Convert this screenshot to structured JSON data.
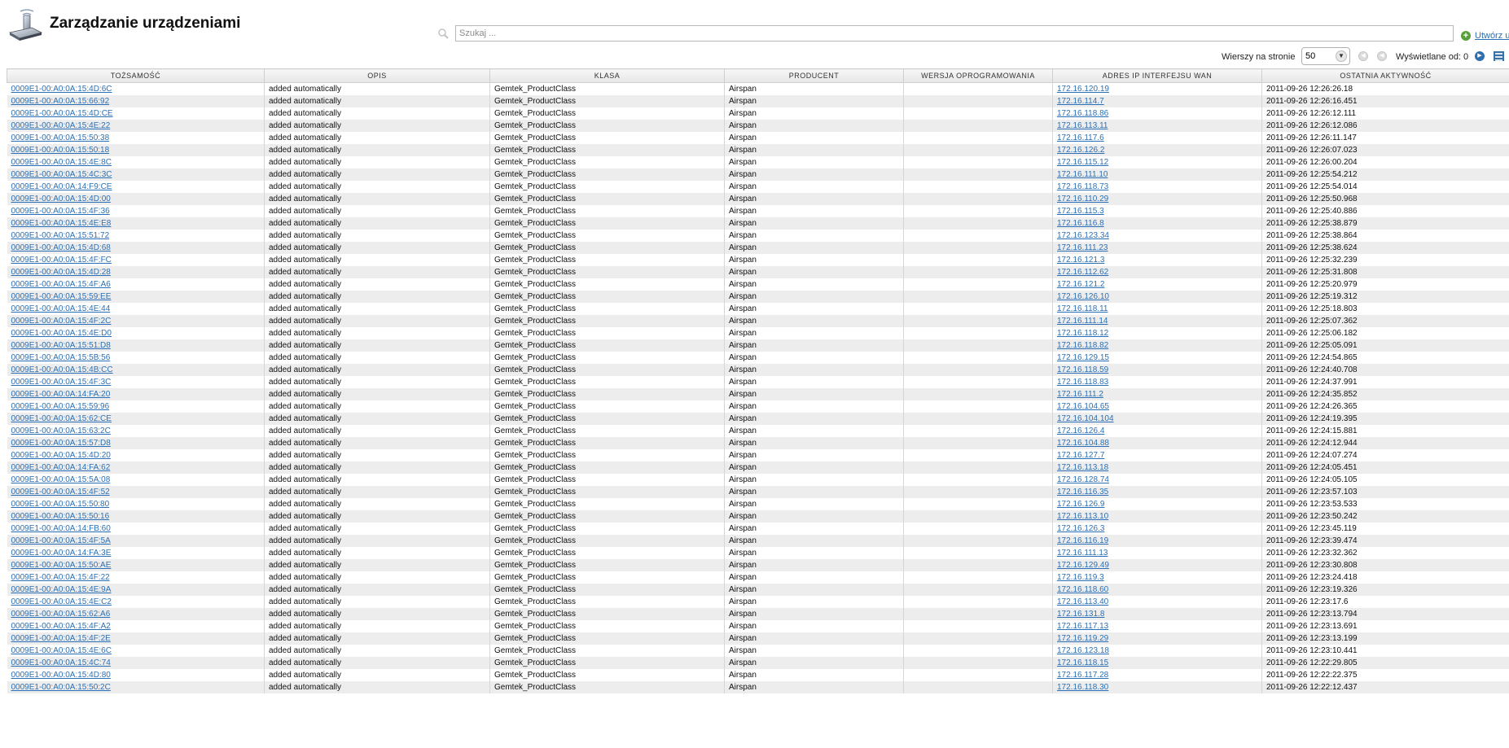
{
  "header": {
    "title": "Zarządzanie urządzeniami",
    "search_placeholder": "Szukaj ...",
    "create_label": "Utwórz u"
  },
  "pager": {
    "rows_label": "Wierszy na stronie",
    "rows_value": "50",
    "shown_label": "Wyświetlane od: 0"
  },
  "table": {
    "columns": [
      "TOŻSAMOŚĆ",
      "OPIS",
      "KLASA",
      "PRODUCENT",
      "WERSJA OPROGRAMOWANIA",
      "ADRES IP INTERFEJSU WAN",
      "OSTATNIA AKTYWNOŚĆ"
    ],
    "rows": [
      [
        "0009E1-00:A0:0A:15:4D:6C",
        "added automatically",
        "Gemtek_ProductClass",
        "Airspan",
        "",
        "172.16.120.19",
        "2011-09-26 12:26:26.18"
      ],
      [
        "0009E1-00:A0:0A:15:66:92",
        "added automatically",
        "Gemtek_ProductClass",
        "Airspan",
        "",
        "172.16.114.7",
        "2011-09-26 12:26:16.451"
      ],
      [
        "0009E1-00:A0:0A:15:4D:CE",
        "added automatically",
        "Gemtek_ProductClass",
        "Airspan",
        "",
        "172.16.118.86",
        "2011-09-26 12:26:12.111"
      ],
      [
        "0009E1-00:A0:0A:15:4E:22",
        "added automatically",
        "Gemtek_ProductClass",
        "Airspan",
        "",
        "172.16.113.11",
        "2011-09-26 12:26:12.086"
      ],
      [
        "0009E1-00:A0:0A:15:50:38",
        "added automatically",
        "Gemtek_ProductClass",
        "Airspan",
        "",
        "172.16.117.6",
        "2011-09-26 12:26:11.147"
      ],
      [
        "0009E1-00:A0:0A:15:50:18",
        "added automatically",
        "Gemtek_ProductClass",
        "Airspan",
        "",
        "172.16.126.2",
        "2011-09-26 12:26:07.023"
      ],
      [
        "0009E1-00:A0:0A:15:4E:8C",
        "added automatically",
        "Gemtek_ProductClass",
        "Airspan",
        "",
        "172.16.115.12",
        "2011-09-26 12:26:00.204"
      ],
      [
        "0009E1-00:A0:0A:15:4C:3C",
        "added automatically",
        "Gemtek_ProductClass",
        "Airspan",
        "",
        "172.16.111.10",
        "2011-09-26 12:25:54.212"
      ],
      [
        "0009E1-00:A0:0A:14:F9:CE",
        "added automatically",
        "Gemtek_ProductClass",
        "Airspan",
        "",
        "172.16.118.73",
        "2011-09-26 12:25:54.014"
      ],
      [
        "0009E1-00:A0:0A:15:4D:00",
        "added automatically",
        "Gemtek_ProductClass",
        "Airspan",
        "",
        "172.16.110.29",
        "2011-09-26 12:25:50.968"
      ],
      [
        "0009E1-00:A0:0A:15:4F:36",
        "added automatically",
        "Gemtek_ProductClass",
        "Airspan",
        "",
        "172.16.115.3",
        "2011-09-26 12:25:40.886"
      ],
      [
        "0009E1-00:A0:0A:15:4E:E8",
        "added automatically",
        "Gemtek_ProductClass",
        "Airspan",
        "",
        "172.16.116.8",
        "2011-09-26 12:25:38.879"
      ],
      [
        "0009E1-00:A0:0A:15:51:72",
        "added automatically",
        "Gemtek_ProductClass",
        "Airspan",
        "",
        "172.16.123.34",
        "2011-09-26 12:25:38.864"
      ],
      [
        "0009E1-00:A0:0A:15:4D:68",
        "added automatically",
        "Gemtek_ProductClass",
        "Airspan",
        "",
        "172.16.111.23",
        "2011-09-26 12:25:38.624"
      ],
      [
        "0009E1-00:A0:0A:15:4F:FC",
        "added automatically",
        "Gemtek_ProductClass",
        "Airspan",
        "",
        "172.16.121.3",
        "2011-09-26 12:25:32.239"
      ],
      [
        "0009E1-00:A0:0A:15:4D:28",
        "added automatically",
        "Gemtek_ProductClass",
        "Airspan",
        "",
        "172.16.112.62",
        "2011-09-26 12:25:31.808"
      ],
      [
        "0009E1-00:A0:0A:15:4F:A6",
        "added automatically",
        "Gemtek_ProductClass",
        "Airspan",
        "",
        "172.16.121.2",
        "2011-09-26 12:25:20.979"
      ],
      [
        "0009E1-00:A0:0A:15:59:EE",
        "added automatically",
        "Gemtek_ProductClass",
        "Airspan",
        "",
        "172.16.126.10",
        "2011-09-26 12:25:19.312"
      ],
      [
        "0009E1-00:A0:0A:15:4E:44",
        "added automatically",
        "Gemtek_ProductClass",
        "Airspan",
        "",
        "172.16.118.11",
        "2011-09-26 12:25:18.803"
      ],
      [
        "0009E1-00:A0:0A:15:4F:2C",
        "added automatically",
        "Gemtek_ProductClass",
        "Airspan",
        "",
        "172.16.111.14",
        "2011-09-26 12:25:07.362"
      ],
      [
        "0009E1-00:A0:0A:15:4E:D0",
        "added automatically",
        "Gemtek_ProductClass",
        "Airspan",
        "",
        "172.16.118.12",
        "2011-09-26 12:25:06.182"
      ],
      [
        "0009E1-00:A0:0A:15:51:D8",
        "added automatically",
        "Gemtek_ProductClass",
        "Airspan",
        "",
        "172.16.118.82",
        "2011-09-26 12:25:05.091"
      ],
      [
        "0009E1-00:A0:0A:15:5B:56",
        "added automatically",
        "Gemtek_ProductClass",
        "Airspan",
        "",
        "172.16.129.15",
        "2011-09-26 12:24:54.865"
      ],
      [
        "0009E1-00:A0:0A:15:4B:CC",
        "added automatically",
        "Gemtek_ProductClass",
        "Airspan",
        "",
        "172.16.118.59",
        "2011-09-26 12:24:40.708"
      ],
      [
        "0009E1-00:A0:0A:15:4F:3C",
        "added automatically",
        "Gemtek_ProductClass",
        "Airspan",
        "",
        "172.16.118.83",
        "2011-09-26 12:24:37.991"
      ],
      [
        "0009E1-00:A0:0A:14:FA:20",
        "added automatically",
        "Gemtek_ProductClass",
        "Airspan",
        "",
        "172.16.111.2",
        "2011-09-26 12:24:35.852"
      ],
      [
        "0009E1-00:A0:0A:15:59:96",
        "added automatically",
        "Gemtek_ProductClass",
        "Airspan",
        "",
        "172.16.104.65",
        "2011-09-26 12:24:26.365"
      ],
      [
        "0009E1-00:A0:0A:15:62:CE",
        "added automatically",
        "Gemtek_ProductClass",
        "Airspan",
        "",
        "172.16.104.104",
        "2011-09-26 12:24:19.395"
      ],
      [
        "0009E1-00:A0:0A:15:63:2C",
        "added automatically",
        "Gemtek_ProductClass",
        "Airspan",
        "",
        "172.16.126.4",
        "2011-09-26 12:24:15.881"
      ],
      [
        "0009E1-00:A0:0A:15:57:D8",
        "added automatically",
        "Gemtek_ProductClass",
        "Airspan",
        "",
        "172.16.104.88",
        "2011-09-26 12:24:12.944"
      ],
      [
        "0009E1-00:A0:0A:15:4D:20",
        "added automatically",
        "Gemtek_ProductClass",
        "Airspan",
        "",
        "172.16.127.7",
        "2011-09-26 12:24:07.274"
      ],
      [
        "0009E1-00:A0:0A:14:FA:62",
        "added automatically",
        "Gemtek_ProductClass",
        "Airspan",
        "",
        "172.16.113.18",
        "2011-09-26 12:24:05.451"
      ],
      [
        "0009E1-00:A0:0A:15:5A:08",
        "added automatically",
        "Gemtek_ProductClass",
        "Airspan",
        "",
        "172.16.128.74",
        "2011-09-26 12:24:05.105"
      ],
      [
        "0009E1-00:A0:0A:15:4F:52",
        "added automatically",
        "Gemtek_ProductClass",
        "Airspan",
        "",
        "172.16.116.35",
        "2011-09-26 12:23:57.103"
      ],
      [
        "0009E1-00:A0:0A:15:50:80",
        "added automatically",
        "Gemtek_ProductClass",
        "Airspan",
        "",
        "172.16.126.9",
        "2011-09-26 12:23:53.533"
      ],
      [
        "0009E1-00:A0:0A:15:50:16",
        "added automatically",
        "Gemtek_ProductClass",
        "Airspan",
        "",
        "172.16.113.10",
        "2011-09-26 12:23:50.242"
      ],
      [
        "0009E1-00:A0:0A:14:FB:60",
        "added automatically",
        "Gemtek_ProductClass",
        "Airspan",
        "",
        "172.16.126.3",
        "2011-09-26 12:23:45.119"
      ],
      [
        "0009E1-00:A0:0A:15:4F:5A",
        "added automatically",
        "Gemtek_ProductClass",
        "Airspan",
        "",
        "172.16.116.19",
        "2011-09-26 12:23:39.474"
      ],
      [
        "0009E1-00:A0:0A:14:FA:3E",
        "added automatically",
        "Gemtek_ProductClass",
        "Airspan",
        "",
        "172.16.111.13",
        "2011-09-26 12:23:32.362"
      ],
      [
        "0009E1-00:A0:0A:15:50:AE",
        "added automatically",
        "Gemtek_ProductClass",
        "Airspan",
        "",
        "172.16.129.49",
        "2011-09-26 12:23:30.808"
      ],
      [
        "0009E1-00:A0:0A:15:4F:22",
        "added automatically",
        "Gemtek_ProductClass",
        "Airspan",
        "",
        "172.16.119.3",
        "2011-09-26 12:23:24.418"
      ],
      [
        "0009E1-00:A0:0A:15:4E:9A",
        "added automatically",
        "Gemtek_ProductClass",
        "Airspan",
        "",
        "172.16.118.60",
        "2011-09-26 12:23:19.326"
      ],
      [
        "0009E1-00:A0:0A:15:4E:C2",
        "added automatically",
        "Gemtek_ProductClass",
        "Airspan",
        "",
        "172.16.113.40",
        "2011-09-26 12:23:17.6"
      ],
      [
        "0009E1-00:A0:0A:15:62:A6",
        "added automatically",
        "Gemtek_ProductClass",
        "Airspan",
        "",
        "172.16.131.8",
        "2011-09-26 12:23:13.794"
      ],
      [
        "0009E1-00:A0:0A:15:4F:A2",
        "added automatically",
        "Gemtek_ProductClass",
        "Airspan",
        "",
        "172.16.117.13",
        "2011-09-26 12:23:13.691"
      ],
      [
        "0009E1-00:A0:0A:15:4F:2E",
        "added automatically",
        "Gemtek_ProductClass",
        "Airspan",
        "",
        "172.16.119.29",
        "2011-09-26 12:23:13.199"
      ],
      [
        "0009E1-00:A0:0A:15:4E:6C",
        "added automatically",
        "Gemtek_ProductClass",
        "Airspan",
        "",
        "172.16.123.18",
        "2011-09-26 12:23:10.441"
      ],
      [
        "0009E1-00:A0:0A:15:4C:74",
        "added automatically",
        "Gemtek_ProductClass",
        "Airspan",
        "",
        "172.16.118.15",
        "2011-09-26 12:22:29.805"
      ],
      [
        "0009E1-00:A0:0A:15:4D:80",
        "added automatically",
        "Gemtek_ProductClass",
        "Airspan",
        "",
        "172.16.117.28",
        "2011-09-26 12:22:22.375"
      ],
      [
        "0009E1-00:A0:0A:15:50:2C",
        "added automatically",
        "Gemtek_ProductClass",
        "Airspan",
        "",
        "172.16.118.30",
        "2011-09-26 12:22:12.437"
      ]
    ]
  },
  "colors": {
    "link": "#2a6fb5",
    "row_alt": "#ededed",
    "accent_green": "#5a9f3e"
  },
  "icons": {
    "logo": "device-management-icon",
    "search": "search-icon",
    "create": "plus-icon",
    "first": "first-page-icon",
    "prev": "prev-page-icon",
    "next": "next-page-icon",
    "columns": "columns-icon"
  }
}
